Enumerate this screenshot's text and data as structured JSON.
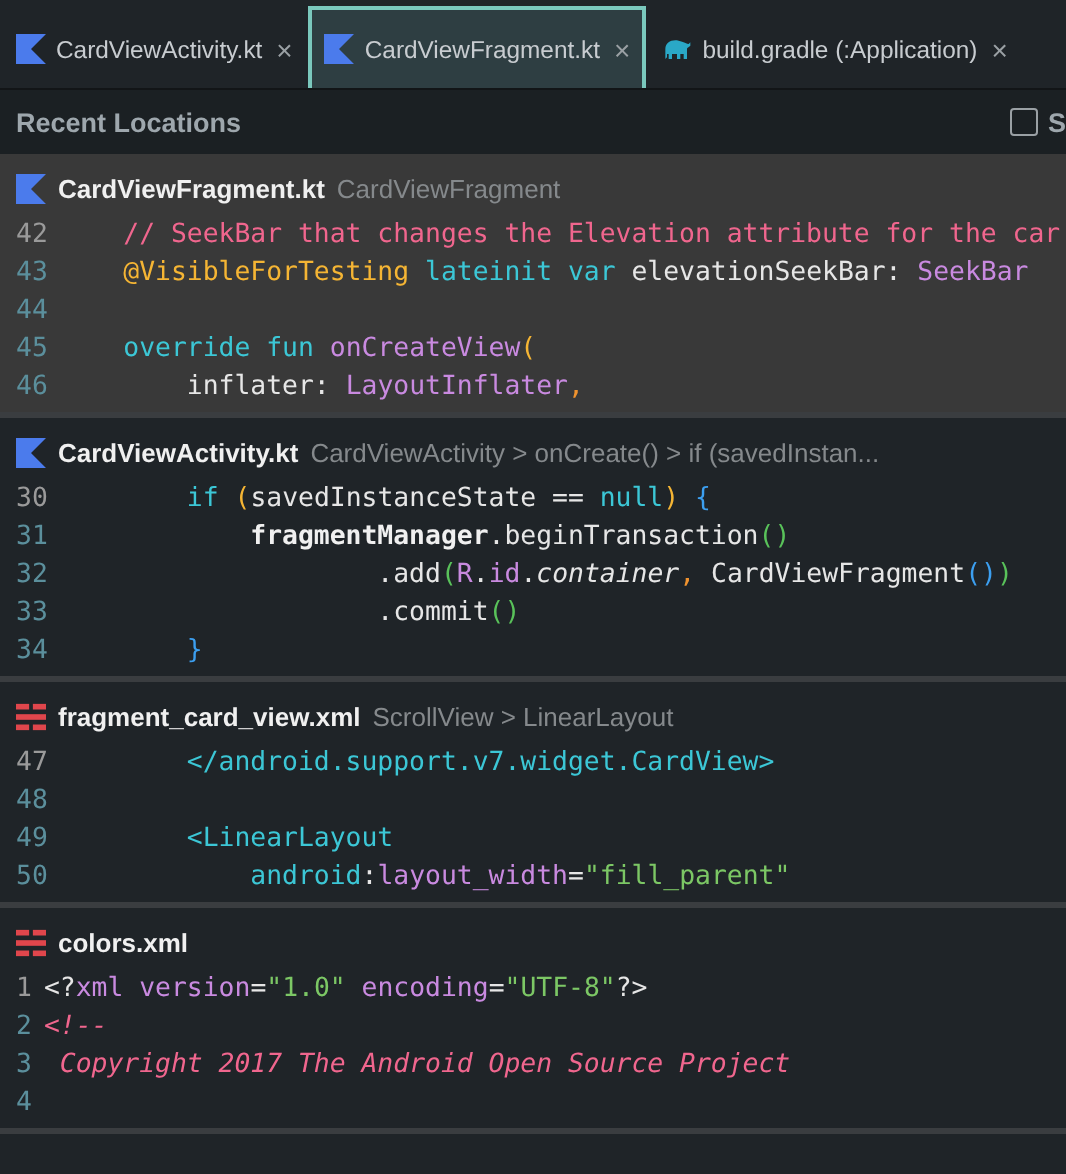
{
  "tabs": [
    {
      "label": "CardViewActivity.kt",
      "kind": "kotlin",
      "selected": false,
      "close": "×"
    },
    {
      "label": "CardViewFragment.kt",
      "kind": "kotlin",
      "selected": true,
      "close": "×"
    },
    {
      "label": "build.gradle (:Application)",
      "kind": "gradle",
      "selected": false,
      "close": "×"
    }
  ],
  "popup": {
    "title": "Recent Locations",
    "option": {
      "label": "S",
      "checked": false
    }
  },
  "locations": [
    {
      "file": "CardViewFragment.kt",
      "kind": "kotlin",
      "path": "CardViewFragment",
      "selected": true,
      "lines": [
        {
          "number": "42",
          "current": true,
          "segments": [
            {
              "kind": "comment",
              "text": "    // SeekBar that changes the Elevation attribute for the car"
            }
          ]
        },
        {
          "number": "43",
          "current": false,
          "segments": [
            {
              "kind": "annotation",
              "text": "    @VisibleForTesting "
            },
            {
              "kind": "keyword",
              "text": "lateinit var "
            },
            {
              "kind": "plain",
              "text": "elevationSeekBar: "
            },
            {
              "kind": "type",
              "text": "SeekBar"
            }
          ]
        },
        {
          "number": "44",
          "current": false
        },
        {
          "number": "45",
          "current": false,
          "segments": [
            {
              "kind": "keyword",
              "text": "    override fun "
            },
            {
              "kind": "type",
              "text": "onCreateView"
            },
            {
              "kind": "bracket1",
              "text": "("
            }
          ]
        },
        {
          "number": "46",
          "current": false,
          "segments": [
            {
              "kind": "plain",
              "text": "        inflater: "
            },
            {
              "kind": "type",
              "text": "LayoutInflater"
            },
            {
              "kind": "comma",
              "text": ","
            }
          ]
        }
      ]
    },
    {
      "file": "CardViewActivity.kt",
      "kind": "kotlin",
      "path": "CardViewActivity > onCreate() > if (savedInstan...",
      "selected": false,
      "lines": [
        {
          "number": "30",
          "current": true,
          "segments": [
            {
              "kind": "keyword",
              "text": "        if "
            },
            {
              "kind": "bracket1",
              "text": "("
            },
            {
              "kind": "plain",
              "text": "savedInstanceState == "
            },
            {
              "kind": "keyword",
              "text": "null"
            },
            {
              "kind": "bracket1",
              "text": ") "
            },
            {
              "kind": "bracket3",
              "text": "{"
            }
          ]
        },
        {
          "number": "31",
          "current": false,
          "segments": [
            {
              "kind": "bold",
              "text": "            fragmentManager"
            },
            {
              "kind": "plain",
              "text": ".beginTransaction"
            },
            {
              "kind": "bracket2",
              "text": "()"
            }
          ]
        },
        {
          "number": "32",
          "current": false,
          "segments": [
            {
              "kind": "plain",
              "text": "                    .add"
            },
            {
              "kind": "bracket2",
              "text": "("
            },
            {
              "kind": "type",
              "text": "R"
            },
            {
              "kind": "plain",
              "text": "."
            },
            {
              "kind": "type",
              "text": "id"
            },
            {
              "kind": "plain",
              "text": "."
            },
            {
              "kind": "italic",
              "text": "container"
            },
            {
              "kind": "comma",
              "text": ","
            },
            {
              "kind": "plain",
              "text": " CardViewFragment"
            },
            {
              "kind": "bracket3",
              "text": "()"
            },
            {
              "kind": "bracket2",
              "text": ")"
            }
          ]
        },
        {
          "number": "33",
          "current": false,
          "segments": [
            {
              "kind": "plain",
              "text": "                    .commit"
            },
            {
              "kind": "bracket2",
              "text": "()"
            }
          ]
        },
        {
          "number": "34",
          "current": false,
          "segments": [
            {
              "kind": "bracket3",
              "text": "        }"
            }
          ]
        }
      ]
    },
    {
      "file": "fragment_card_view.xml",
      "kind": "xml",
      "path": "ScrollView > LinearLayout",
      "selected": false,
      "lines": [
        {
          "number": "47",
          "current": true,
          "segments": [
            {
              "kind": "tag",
              "text": "        </android.support.v7.widget.CardView>"
            }
          ]
        },
        {
          "number": "48",
          "current": false
        },
        {
          "number": "49",
          "current": false,
          "segments": [
            {
              "kind": "tag",
              "text": "        <LinearLayout"
            }
          ]
        },
        {
          "number": "50",
          "current": false,
          "segments": [
            {
              "kind": "tag",
              "text": "            android"
            },
            {
              "kind": "plain",
              "text": ":"
            },
            {
              "kind": "type",
              "text": "layout_width"
            },
            {
              "kind": "plain",
              "text": "="
            },
            {
              "kind": "string",
              "text": "\"fill_parent\""
            }
          ]
        }
      ]
    },
    {
      "file": "colors.xml",
      "kind": "xml",
      "selected": false,
      "lines": [
        {
          "number": "1",
          "current": true,
          "segments": [
            {
              "kind": "plain",
              "text": "<?"
            },
            {
              "kind": "type",
              "text": "xml version"
            },
            {
              "kind": "plain",
              "text": "="
            },
            {
              "kind": "string",
              "text": "\"1.0\""
            },
            {
              "kind": "type",
              "text": " encoding"
            },
            {
              "kind": "plain",
              "text": "="
            },
            {
              "kind": "string",
              "text": "\"UTF-8\""
            },
            {
              "kind": "plain",
              "text": "?>"
            }
          ]
        },
        {
          "number": "2",
          "current": false,
          "segments": [
            {
              "kind": "doccomment",
              "text": "<!--"
            }
          ]
        },
        {
          "number": "3",
          "current": false,
          "segments": [
            {
              "kind": "doccomment",
              "text": " Copyright 2017 The Android Open Source Project"
            }
          ]
        },
        {
          "number": "4",
          "current": false
        }
      ]
    }
  ]
}
